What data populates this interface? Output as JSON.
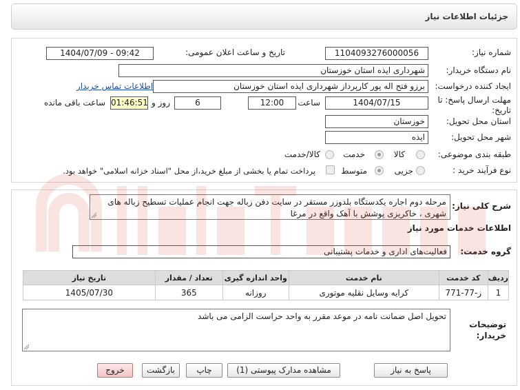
{
  "page": {
    "title": "جزئیات اطلاعات نیاز"
  },
  "form": {
    "need_number_label": "شماره نیاز:",
    "need_number": "1104093276000056",
    "announce_label": "تاریخ و ساعت اعلان عمومی:",
    "announce_value": "1404/07/09 - 09:42",
    "buyer_org_label": "نام دستگاه خریدار:",
    "buyer_org": "شهرداری ایذه استان خوزستان",
    "creator_label": "ایجاد کننده درخواست:",
    "creator": "برزو فتح اله پور کارپرداز شهرداری ایذه استان خوزستان",
    "contact_link": "اطلاعات تماس خریدار",
    "deadline_label_1": "مهلت ارسال پاسخ: تا",
    "deadline_label_2": "تاریخ:",
    "deadline_date": "1404/07/15",
    "time_label": "ساعت",
    "deadline_time": "12:00",
    "days_value": "6",
    "days_label": "روز و",
    "remaining_time": "01:46:51",
    "remaining_label": "ساعت باقی مانده",
    "province_label": "استان محل تحویل:",
    "province": "خوزستان",
    "city_label": "شهر محل تحویل:",
    "city": "ایذه",
    "category_label": "طبقه بندی موضوعی:",
    "category_options": [
      "کالا",
      "خدمت",
      "کالا/خدمت"
    ],
    "process_label": "نوع فرآیند خرید :",
    "process_options": [
      "جزیی",
      "متوسط"
    ],
    "treasury_note": "پرداخت تمام یا بخشی از مبلغ خرید،از محل \"اسناد خزانه اسلامی\" خواهد بود."
  },
  "description": {
    "label": "شرح کلی نیاز:",
    "text": "مرحله دوم اجاره یکدستگاه بلدوزر مستقر در سایت دفن زباله جهت انجام عملیات تسطیح زباله های شهری ، خاکریزی پوشش با آهک واقع در مرغا"
  },
  "services": {
    "section_title": "اطلاعات خدمات مورد نیاز",
    "group_label": "گروه خدمت:",
    "group_value": "فعالیت‌های اداری و خدمات پشتیبانی",
    "columns": [
      "ردیف",
      "کد خدمت",
      "نام خدمت",
      "واحد اندازه گیری",
      "تعداد / مقدار",
      "تاریخ نیاز"
    ],
    "rows": [
      {
        "index": "1",
        "code": "ز-77-771",
        "name": "کرایه وسایل نقلیه موتوری",
        "unit": "روزانه",
        "qty": "365",
        "date": "1405/07/30"
      }
    ]
  },
  "buyer_notes": {
    "label_1": "توضیحات",
    "label_2": "خریدار:",
    "text": "تحویل اصل ضمانت نامه در موعد مقرر به واحد حراست الزامی می باشد"
  },
  "buttons": {
    "reply": "پاسخ به نیاز",
    "attachments": "مشاهده مدارک پیوستی (1)",
    "print": "چاپ",
    "back": "بازگشت",
    "exit": "خروج"
  },
  "colors": {
    "link": "#1a4fa8",
    "time_highlight": "#ffffc8",
    "exit_button": "#f2c4c4",
    "watermark": "#d23a2a"
  }
}
